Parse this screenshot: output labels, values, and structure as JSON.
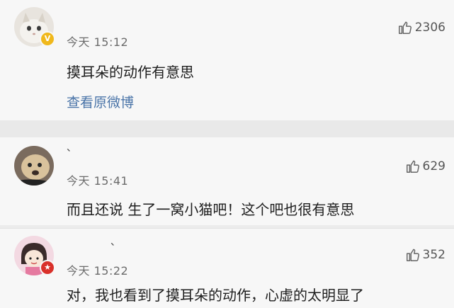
{
  "comments": [
    {
      "username": "",
      "time": "今天 15:12",
      "likes": "2306",
      "text": "摸耳朵的动作有意思",
      "link": "查看原微博",
      "badge": "V"
    },
    {
      "username": "、",
      "time": "今天 15:41",
      "likes": "629",
      "text": "而且还说  生了一窝小猫吧！这个吧也很有意思"
    },
    {
      "username": "、",
      "time": "今天 15:22",
      "likes": "352",
      "text": "对，我也看到了摸耳朵的动作，心虚的太明显了",
      "badge": "★"
    }
  ],
  "icons": {
    "like": "thumbs-up-icon"
  },
  "colors": {
    "link": "#4a74a8",
    "verified_badge": "#f0b81c",
    "red_badge": "#d9302a"
  }
}
